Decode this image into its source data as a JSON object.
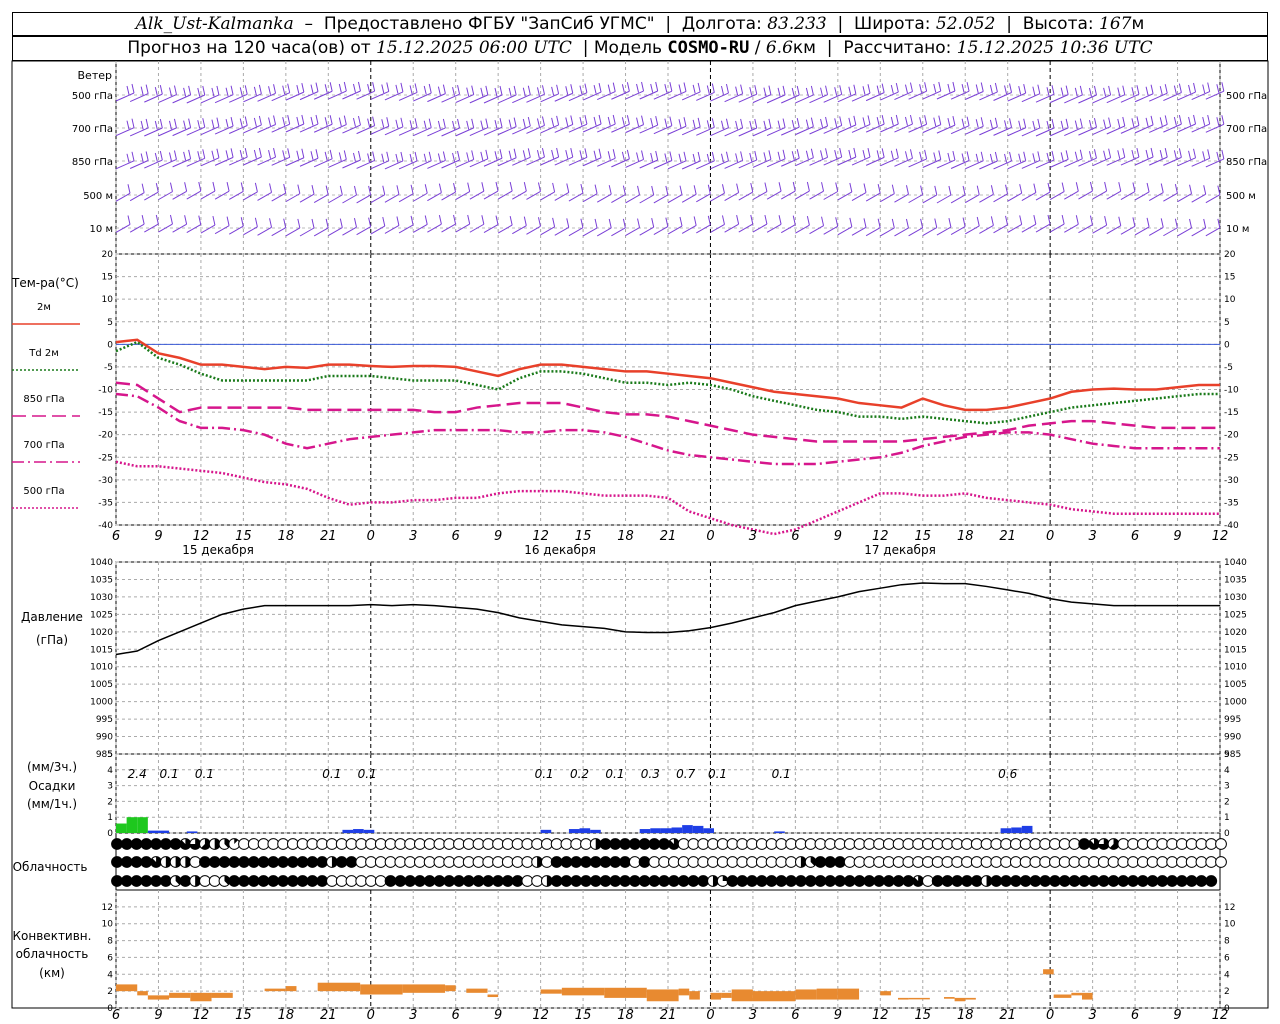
{
  "header": {
    "station": "Alk_Ust-Kalmanka",
    "provider": "Предоставлено ФГБУ \"ЗапСиб УГМС\"",
    "lon_label": "Долгота:",
    "lon": "83.233",
    "lat_label": "Широта:",
    "lat": "52.052",
    "alt_label": "Высота:",
    "alt": "167",
    "alt_unit": "м",
    "forecast_text": "Прогноз на 120 часа(ов) от",
    "forecast_from": "15.12.2025 06:00 UTC",
    "model_label": "Модель",
    "model": "COSMO-RU",
    "model_res": "6.6",
    "model_res_unit": "км",
    "calc_label": "Рассчитано:",
    "calc": "15.12.2025 10:36 UTC"
  },
  "wind": {
    "title": "Ветер",
    "levels": [
      "500 гПа",
      "700 гПа",
      "850 гПа",
      "500 м",
      "10 м"
    ],
    "colors": {
      "barb": "#7a3fd6"
    }
  },
  "time_axis": {
    "ticks": [
      "6",
      "9",
      "12",
      "15",
      "18",
      "21",
      "0",
      "3",
      "6",
      "9",
      "12",
      "15",
      "18",
      "21",
      "0",
      "3",
      "6",
      "9",
      "12",
      "15",
      "18",
      "21",
      "0",
      "3",
      "6",
      "9",
      "12"
    ],
    "dates": [
      "15 декабря",
      "16 декабря",
      "17 декабря"
    ]
  },
  "chart_data": [
    {
      "type": "line",
      "panel": "temperature",
      "title": "Тем-ра(°C)",
      "ylim": [
        -40,
        20
      ],
      "yticks": [
        20,
        15,
        10,
        5,
        0,
        -5,
        -10,
        -15,
        -20,
        -25,
        -30,
        -35,
        -40
      ],
      "x_hours": [
        0,
        3,
        6,
        9,
        12,
        15,
        18,
        21,
        24,
        27,
        30,
        33,
        36,
        39,
        42,
        45,
        48,
        51,
        54,
        57,
        60,
        63,
        66,
        69,
        72,
        75,
        78,
        81,
        84,
        87,
        90,
        93,
        96,
        99,
        102,
        105,
        108,
        111,
        114,
        117,
        120,
        123,
        126,
        129,
        132,
        135,
        138,
        141,
        144,
        147,
        150,
        153,
        156
      ],
      "series": [
        {
          "name": "2м",
          "color": "#e8402a",
          "style": "solid",
          "values": [
            0.5,
            1,
            -2,
            -3,
            -4.5,
            -4.5,
            -5,
            -5.5,
            -5,
            -5.2,
            -4.5,
            -4.5,
            -4.8,
            -5,
            -4.8,
            -4.8,
            -5,
            -6,
            -7,
            -5.5,
            -4.5,
            -4.5,
            -5,
            -5.5,
            -6,
            -6,
            -6.5,
            -7,
            -7.5,
            -8.5,
            -9.5,
            -10.5,
            -11,
            -11.5,
            -12,
            -13,
            -13.5,
            -14,
            -12,
            -13.5,
            -14.5,
            -14.5,
            -14,
            -13,
            -12,
            -10.5,
            -10,
            -9.8,
            -10,
            -10,
            -9.5,
            -9,
            -9
          ]
        },
        {
          "name": "Td 2м",
          "color": "#1a7a1a",
          "style": "dotted",
          "values": [
            -1.5,
            0.5,
            -3,
            -4.5,
            -6.5,
            -8,
            -8,
            -8,
            -8,
            -8,
            -7,
            -7,
            -7,
            -7.5,
            -8,
            -8,
            -8,
            -9,
            -10,
            -7.5,
            -6,
            -6,
            -6.5,
            -7.5,
            -8.5,
            -8.5,
            -9,
            -8.5,
            -9,
            -10,
            -11.5,
            -12.5,
            -13.5,
            -14.5,
            -15,
            -16,
            -16,
            -16.5,
            -16,
            -16.5,
            -17,
            -17.5,
            -17,
            -16,
            -15,
            -14,
            -13.5,
            -13,
            -12.5,
            -12,
            -11.5,
            -11,
            -11
          ]
        },
        {
          "name": "850 гПа",
          "color": "#d6168c",
          "style": "dash",
          "values": [
            -8.5,
            -9,
            -12,
            -15,
            -14,
            -14,
            -14,
            -14,
            -14,
            -14.5,
            -14.5,
            -14.5,
            -14.5,
            -14.5,
            -14.5,
            -15,
            -15,
            -14,
            -13.5,
            -13,
            -13,
            -13,
            -14,
            -15,
            -15.5,
            -15.5,
            -16,
            -17,
            -18,
            -19,
            -20,
            -20.5,
            -21,
            -21.5,
            -21.5,
            -21.5,
            -21.5,
            -21.5,
            -21,
            -20.5,
            -20,
            -19.5,
            -19,
            -18,
            -17.5,
            -17,
            -17,
            -17.5,
            -18,
            -18.5,
            -18.5,
            -18.5,
            -18.5
          ]
        },
        {
          "name": "700 гПа",
          "color": "#d6168c",
          "style": "dashdot",
          "values": [
            -11,
            -11.5,
            -14,
            -17,
            -18.5,
            -18.5,
            -19,
            -20,
            -22,
            -23,
            -22,
            -21,
            -20.5,
            -20,
            -19.5,
            -19,
            -19,
            -19,
            -19,
            -19.5,
            -19.5,
            -19,
            -19,
            -19.5,
            -20.5,
            -22,
            -23.5,
            -24.5,
            -25,
            -25.5,
            -26,
            -26.5,
            -26.5,
            -26.5,
            -26,
            -25.5,
            -25,
            -24,
            -22.5,
            -21.5,
            -20.5,
            -20,
            -19.5,
            -19.5,
            -20,
            -21,
            -22,
            -22.5,
            -23,
            -23,
            -23,
            -23,
            -23
          ]
        },
        {
          "name": "500 гПа",
          "color": "#d6168c",
          "style": "dotted",
          "values": [
            -26,
            -27,
            -27,
            -27.5,
            -28,
            -28.5,
            -29.5,
            -30.5,
            -31,
            -32,
            -34,
            -35.5,
            -35,
            -35,
            -34.5,
            -34.5,
            -34,
            -34,
            -33,
            -32.5,
            -32.5,
            -32.5,
            -33,
            -33.5,
            -33.5,
            -33.5,
            -34,
            -37,
            -38.5,
            -40,
            -41,
            -42,
            -41,
            -39,
            -37,
            -35,
            -33,
            -33,
            -33.5,
            -33.5,
            -33,
            -34,
            -34.5,
            -35,
            -35.5,
            -36.5,
            -37,
            -37.5,
            -37.5,
            -37.5,
            -37.5,
            -37.5,
            -37.5
          ]
        }
      ]
    },
    {
      "type": "line",
      "panel": "pressure",
      "title": "Давление",
      "unit": "(гПа)",
      "ylim": [
        985,
        1040
      ],
      "yticks": [
        1040,
        1035,
        1030,
        1025,
        1020,
        1015,
        1010,
        1005,
        1000,
        995,
        990,
        985
      ],
      "x_hours": [
        0,
        3,
        6,
        9,
        12,
        15,
        18,
        21,
        24,
        27,
        30,
        33,
        36,
        39,
        42,
        45,
        48,
        51,
        54,
        57,
        60,
        63,
        66,
        69,
        72,
        75,
        78,
        81,
        84,
        87,
        90,
        93,
        96,
        99,
        102,
        105,
        108,
        111,
        114,
        117,
        120,
        123,
        126,
        129,
        132,
        135,
        138,
        141,
        144,
        147,
        150,
        153,
        156
      ],
      "series": [
        {
          "name": "p",
          "color": "#000000",
          "values": [
            1013.5,
            1014.5,
            1017.5,
            1020,
            1022.5,
            1025,
            1026.5,
            1027.5,
            1027.5,
            1027.5,
            1027.5,
            1027.5,
            1027.8,
            1027.5,
            1027.8,
            1027.5,
            1027,
            1026.5,
            1025.5,
            1024,
            1023,
            1022,
            1021.5,
            1021,
            1020,
            1019.8,
            1019.8,
            1020.3,
            1021.2,
            1022.5,
            1024,
            1025.5,
            1027.5,
            1028.8,
            1030,
            1031.5,
            1032.5,
            1033.5,
            1034,
            1033.8,
            1033.8,
            1033,
            1032,
            1031,
            1029.5,
            1028.5,
            1028,
            1027.5,
            1027.5,
            1027.5,
            1027.5,
            1027.5,
            1027.5
          ]
        }
      ]
    },
    {
      "type": "bar",
      "panel": "precipitation",
      "title": "Осадки",
      "unit_top": "(мм/3ч.)",
      "unit_bottom": "(мм/1ч.)",
      "ylim": [
        0,
        5
      ],
      "yticks": [
        5,
        4,
        3,
        2,
        1,
        0
      ],
      "labels_3h": [
        {
          "h": 3,
          "v": "2.4"
        },
        {
          "h": 7.5,
          "v": "0.1"
        },
        {
          "h": 12.5,
          "v": "0.1"
        },
        {
          "h": 30.5,
          "v": "0.1"
        },
        {
          "h": 35.5,
          "v": "0.1"
        },
        {
          "h": 60.5,
          "v": "0.1"
        },
        {
          "h": 65.5,
          "v": "0.2"
        },
        {
          "h": 70.5,
          "v": "0.1"
        },
        {
          "h": 75.5,
          "v": "0.3"
        },
        {
          "h": 80.5,
          "v": "0.7"
        },
        {
          "h": 85,
          "v": "0.1"
        },
        {
          "h": 94,
          "v": "0.1"
        },
        {
          "h": 126,
          "v": "0.6"
        }
      ],
      "bars_1h": [
        {
          "h": 0,
          "v": 0.6,
          "kind": "rain"
        },
        {
          "h": 1.5,
          "v": 1.0,
          "kind": "rain"
        },
        {
          "h": 3,
          "v": 1.0,
          "kind": "rain"
        },
        {
          "h": 4.5,
          "v": 0.15,
          "kind": "snow"
        },
        {
          "h": 6,
          "v": 0.15,
          "kind": "snow"
        },
        {
          "h": 10,
          "v": 0.1,
          "kind": "snow"
        },
        {
          "h": 32,
          "v": 0.2,
          "kind": "snow"
        },
        {
          "h": 33.5,
          "v": 0.25,
          "kind": "snow"
        },
        {
          "h": 35,
          "v": 0.2,
          "kind": "snow"
        },
        {
          "h": 60,
          "v": 0.2,
          "kind": "snow"
        },
        {
          "h": 64,
          "v": 0.25,
          "kind": "snow"
        },
        {
          "h": 65.5,
          "v": 0.3,
          "kind": "snow"
        },
        {
          "h": 67,
          "v": 0.2,
          "kind": "snow"
        },
        {
          "h": 74,
          "v": 0.25,
          "kind": "snow"
        },
        {
          "h": 75.5,
          "v": 0.3,
          "kind": "snow"
        },
        {
          "h": 77,
          "v": 0.3,
          "kind": "snow"
        },
        {
          "h": 78.5,
          "v": 0.35,
          "kind": "snow"
        },
        {
          "h": 80,
          "v": 0.5,
          "kind": "snow"
        },
        {
          "h": 81.5,
          "v": 0.45,
          "kind": "snow"
        },
        {
          "h": 83,
          "v": 0.3,
          "kind": "snow"
        },
        {
          "h": 93,
          "v": 0.1,
          "kind": "snow"
        },
        {
          "h": 125,
          "v": 0.3,
          "kind": "snow"
        },
        {
          "h": 126.5,
          "v": 0.35,
          "kind": "snow"
        },
        {
          "h": 128,
          "v": 0.45,
          "kind": "snow"
        }
      ],
      "colors": {
        "rain": "#1ec81e",
        "snow": "#1e3ee6"
      }
    },
    {
      "type": "table",
      "panel": "cloudiness",
      "title": "Облачность",
      "rows_oktas": [
        "88888887654310000000000000000000000000000000000004888888870000000000000000000000000000000000000000087650000000000000",
        "88887444088888888888884880000000000000000004088888888080000000000000004388800000000000000000000000000000000000000000",
        "88888838400388888888880000008888888888888800488888888888888884288888888888888888887088888488888888888888888888888"
      ]
    },
    {
      "type": "bar",
      "panel": "convective",
      "title": "Конвективн. облачность",
      "unit": "(км)",
      "ylim": [
        0,
        14
      ],
      "yticks": [
        12,
        10,
        8,
        6,
        4,
        2,
        0
      ],
      "color": "#e88a30",
      "segments": [
        {
          "h0": 0,
          "h1": 3,
          "lo": 2,
          "hi": 2.8
        },
        {
          "h0": 3,
          "h1": 4.5,
          "lo": 1.5,
          "hi": 2
        },
        {
          "h0": 4.5,
          "h1": 7.5,
          "lo": 1,
          "hi": 1.5
        },
        {
          "h0": 7.5,
          "h1": 10.5,
          "lo": 1.2,
          "hi": 1.8
        },
        {
          "h0": 10.5,
          "h1": 13.5,
          "lo": 0.8,
          "hi": 1.8
        },
        {
          "h0": 13.5,
          "h1": 16.5,
          "lo": 1.2,
          "hi": 1.8
        },
        {
          "h0": 21,
          "h1": 24,
          "lo": 2,
          "hi": 2.3
        },
        {
          "h0": 24,
          "h1": 25.5,
          "lo": 2,
          "hi": 2.6
        },
        {
          "h0": 28.5,
          "h1": 34.5,
          "lo": 2,
          "hi": 3
        },
        {
          "h0": 34.5,
          "h1": 40.5,
          "lo": 1.6,
          "hi": 2.8
        },
        {
          "h0": 40.5,
          "h1": 46.5,
          "lo": 1.8,
          "hi": 2.8
        },
        {
          "h0": 46.5,
          "h1": 48,
          "lo": 2,
          "hi": 2.7
        },
        {
          "h0": 49.5,
          "h1": 52.5,
          "lo": 1.8,
          "hi": 2.3
        },
        {
          "h0": 52.5,
          "h1": 54,
          "lo": 1.3,
          "hi": 1.6
        },
        {
          "h0": 60,
          "h1": 63,
          "lo": 1.7,
          "hi": 2.2
        },
        {
          "h0": 63,
          "h1": 69,
          "lo": 1.5,
          "hi": 2.4
        },
        {
          "h0": 69,
          "h1": 75,
          "lo": 1.2,
          "hi": 2.4
        },
        {
          "h0": 75,
          "h1": 79.5,
          "lo": 0.8,
          "hi": 2.2
        },
        {
          "h0": 79.5,
          "h1": 81,
          "lo": 1.5,
          "hi": 2.3
        },
        {
          "h0": 81,
          "h1": 82.5,
          "lo": 1,
          "hi": 2
        },
        {
          "h0": 84,
          "h1": 85.5,
          "lo": 1,
          "hi": 1.8
        },
        {
          "h0": 85.5,
          "h1": 87,
          "lo": 1.2,
          "hi": 1.8
        },
        {
          "h0": 87,
          "h1": 90,
          "lo": 0.8,
          "hi": 2.2
        },
        {
          "h0": 90,
          "h1": 96,
          "lo": 0.8,
          "hi": 2
        },
        {
          "h0": 96,
          "h1": 99,
          "lo": 1,
          "hi": 2.2
        },
        {
          "h0": 99,
          "h1": 102,
          "lo": 1,
          "hi": 2.3
        },
        {
          "h0": 102,
          "h1": 105,
          "lo": 1,
          "hi": 2.3
        },
        {
          "h0": 108,
          "h1": 109.5,
          "lo": 1.5,
          "hi": 2
        },
        {
          "h0": 110.5,
          "h1": 112,
          "lo": 1,
          "hi": 1.2
        },
        {
          "h0": 112,
          "h1": 115,
          "lo": 1.1,
          "hi": 1.2
        },
        {
          "h0": 117,
          "h1": 118.5,
          "lo": 1.1,
          "hi": 1.3
        },
        {
          "h0": 118.5,
          "h1": 120,
          "lo": 0.8,
          "hi": 1.2
        },
        {
          "h0": 120,
          "h1": 121.5,
          "lo": 1,
          "hi": 1.2
        },
        {
          "h0": 131,
          "h1": 132.5,
          "lo": 4,
          "hi": 4.6
        },
        {
          "h0": 132.5,
          "h1": 135,
          "lo": 1.2,
          "hi": 1.6
        },
        {
          "h0": 135,
          "h1": 136.5,
          "lo": 1.5,
          "hi": 1.8
        },
        {
          "h0": 136.5,
          "h1": 138,
          "lo": 1,
          "hi": 1.8
        }
      ]
    }
  ]
}
